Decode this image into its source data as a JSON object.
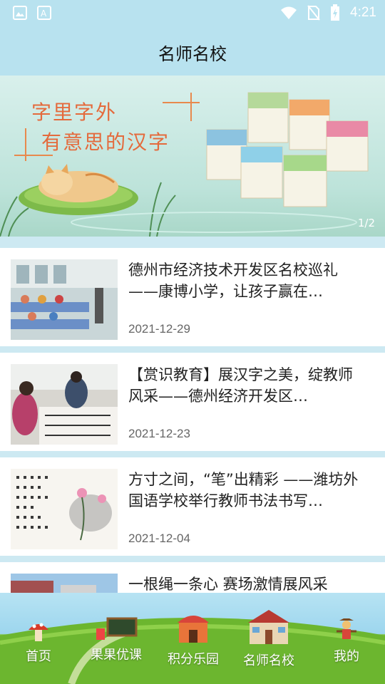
{
  "status_bar": {
    "time": "4:21",
    "icons": [
      "image-icon",
      "a-icon",
      "wifi-icon",
      "no-sim-icon",
      "battery-icon"
    ]
  },
  "header": {
    "title": "名师名校"
  },
  "banner": {
    "line1": "字里字外",
    "line2": "有意思的汉字",
    "indicator": "1/2"
  },
  "articles": [
    {
      "title": "德州市经济技术开发区名校巡礼 ——康博小学，让孩子赢在…",
      "date": "2021-12-29"
    },
    {
      "title": "【赏识教育】展汉字之美，绽教师风采——德州经济开发区…",
      "date": "2021-12-23"
    },
    {
      "title": "方寸之间，“笔”出精彩 ——潍坊外国语学校举行教师书法书写…",
      "date": "2021-12-04"
    },
    {
      "title": "一根绳一条心 赛场激情展风采",
      "date": ""
    }
  ],
  "tabbar": {
    "items": [
      {
        "label": "首页",
        "icon": "mushroom-icon"
      },
      {
        "label": "果果优课",
        "icon": "blackboard-icon"
      },
      {
        "label": "积分乐园",
        "icon": "playhouse-icon"
      },
      {
        "label": "名师名校",
        "icon": "school-icon"
      },
      {
        "label": "我的",
        "icon": "scarecrow-icon"
      }
    ]
  },
  "colors": {
    "header_bg": "#b8e2ef",
    "divider": "#cde9f2",
    "banner_text": "#e46a3c",
    "grass": "#6cb62f"
  }
}
